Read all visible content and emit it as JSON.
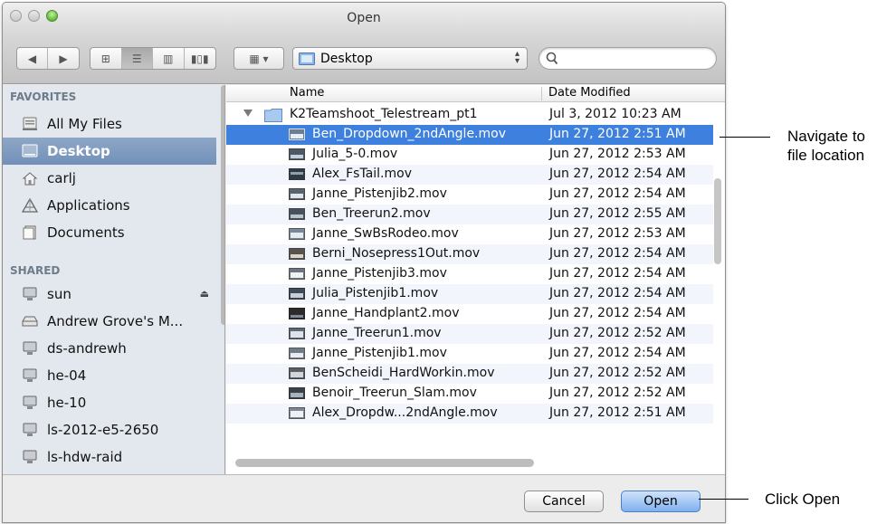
{
  "window": {
    "title": "Open"
  },
  "toolbar": {
    "location": "Desktop",
    "search_placeholder": ""
  },
  "sidebar": {
    "favorites_heading": "FAVORITES",
    "shared_heading": "SHARED",
    "favorites": [
      {
        "label": "All My Files",
        "icon": "all-files-icon"
      },
      {
        "label": "Desktop",
        "icon": "desktop-icon",
        "selected": true
      },
      {
        "label": "carlj",
        "icon": "home-icon"
      },
      {
        "label": "Applications",
        "icon": "applications-icon"
      },
      {
        "label": "Documents",
        "icon": "documents-icon"
      }
    ],
    "shared": [
      {
        "label": "sun",
        "icon": "computer-icon",
        "eject": true
      },
      {
        "label": "Andrew Grove's M...",
        "icon": "network-drive-icon"
      },
      {
        "label": "ds-andrewh",
        "icon": "computer-icon"
      },
      {
        "label": "he-04",
        "icon": "computer-icon"
      },
      {
        "label": "he-10",
        "icon": "computer-icon"
      },
      {
        "label": "ls-2012-e5-2650",
        "icon": "computer-icon"
      },
      {
        "label": "ls-hdw-raid",
        "icon": "computer-icon"
      }
    ]
  },
  "filelist": {
    "columns": {
      "name": "Name",
      "date": "Date Modified"
    },
    "folder": {
      "name": "K2Teamshoot_Telestream_pt1",
      "date": "Jul 3, 2012 10:23 AM"
    },
    "files": [
      {
        "name": "Ben_Dropdown_2ndAngle.mov",
        "date": "Jun 27, 2012 2:51 AM",
        "selected": true
      },
      {
        "name": "Julia_5-0.mov",
        "date": "Jun 27, 2012 2:53 AM"
      },
      {
        "name": "Alex_FsTail.mov",
        "date": "Jun 27, 2012 2:54 AM"
      },
      {
        "name": "Janne_Pistenjib2.mov",
        "date": "Jun 27, 2012 2:54 AM"
      },
      {
        "name": "Ben_Treerun2.mov",
        "date": "Jun 27, 2012 2:55 AM"
      },
      {
        "name": "Janne_SwBsRodeo.mov",
        "date": "Jun 27, 2012 2:53 AM"
      },
      {
        "name": "Berni_Nosepress1Out.mov",
        "date": "Jun 27, 2012 2:54 AM"
      },
      {
        "name": "Janne_Pistenjib3.mov",
        "date": "Jun 27, 2012 2:54 AM"
      },
      {
        "name": "Julia_Pistenjib1.mov",
        "date": "Jun 27, 2012 2:54 AM"
      },
      {
        "name": "Janne_Handplant2.mov",
        "date": "Jun 27, 2012 2:54 AM"
      },
      {
        "name": "Janne_Treerun1.mov",
        "date": "Jun 27, 2012 2:52 AM"
      },
      {
        "name": "Janne_Pistenjib1.mov",
        "date": "Jun 27, 2012 2:54 AM"
      },
      {
        "name": "BenScheidi_HardWorkin.mov",
        "date": "Jun 27, 2012 2:52 AM"
      },
      {
        "name": "Benoir_Treerun_Slam.mov",
        "date": "Jun 27, 2012 2:52 AM"
      },
      {
        "name": "Alex_Dropdw...2ndAngle.mov",
        "date": "Jun 27, 2012 2:51 AM"
      }
    ]
  },
  "buttons": {
    "cancel": "Cancel",
    "open": "Open"
  },
  "callouts": {
    "navigate_line1": "Navigate to",
    "navigate_line2": "file location",
    "click_open": "Click Open"
  },
  "colors": {
    "selection": "#3d80de",
    "sidebar_selection": "#7d98be",
    "sidebar_bg": "#e3e8ee"
  }
}
